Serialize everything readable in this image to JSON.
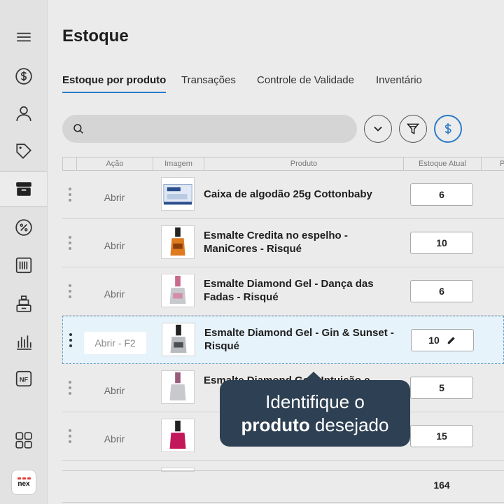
{
  "sidebar": {
    "items": [
      {
        "icon": "menu-icon"
      },
      {
        "icon": "dollar-circle-icon"
      },
      {
        "icon": "user-icon"
      },
      {
        "icon": "tag-icon"
      },
      {
        "icon": "box-icon",
        "active": true
      },
      {
        "icon": "discount-icon"
      },
      {
        "icon": "barcode-icon"
      },
      {
        "icon": "register-icon"
      },
      {
        "icon": "bar-chart-icon"
      },
      {
        "icon": "nf-document-icon",
        "label": "NF"
      },
      {
        "icon": "grid-apps-icon"
      }
    ],
    "logo_text": "nex"
  },
  "page": {
    "title": "Estoque"
  },
  "tabs": [
    {
      "label": "Estoque por produto",
      "active": true
    },
    {
      "label": "Transações"
    },
    {
      "label": "Controle de Validade"
    },
    {
      "label": "Inventário"
    }
  ],
  "search": {
    "placeholder": ""
  },
  "table": {
    "columns": [
      "Ação",
      "Imagem",
      "Produto",
      "Estoque Atual",
      "P"
    ],
    "open_label": "Abrir",
    "open_label_selected": "Abrir - F2",
    "rows": [
      {
        "product": "Caixa de algodão 25g Cottonbaby",
        "stock": "6"
      },
      {
        "product": "Esmalte Credita no espelho - ManiCores - Risqué",
        "stock": "10"
      },
      {
        "product": "Esmalte Diamond Gel - Dança das Fadas - Risqué",
        "stock": "6"
      },
      {
        "product": "Esmalte Diamond Gel - Gin & Sunset - Risqué",
        "stock": "10",
        "selected": true
      },
      {
        "product": "Esmalte Diamond Gel - Intuição e",
        "stock": "5"
      },
      {
        "product": "",
        "stock": "15"
      }
    ],
    "total": "164"
  },
  "tooltip": {
    "line1": "Identifique o",
    "bold": "produto",
    "rest": " desejado"
  },
  "colors": {
    "accent": "#2a7ac9",
    "tooltip_bg": "#2e4053",
    "highlight_row": "#e6f3fb"
  }
}
